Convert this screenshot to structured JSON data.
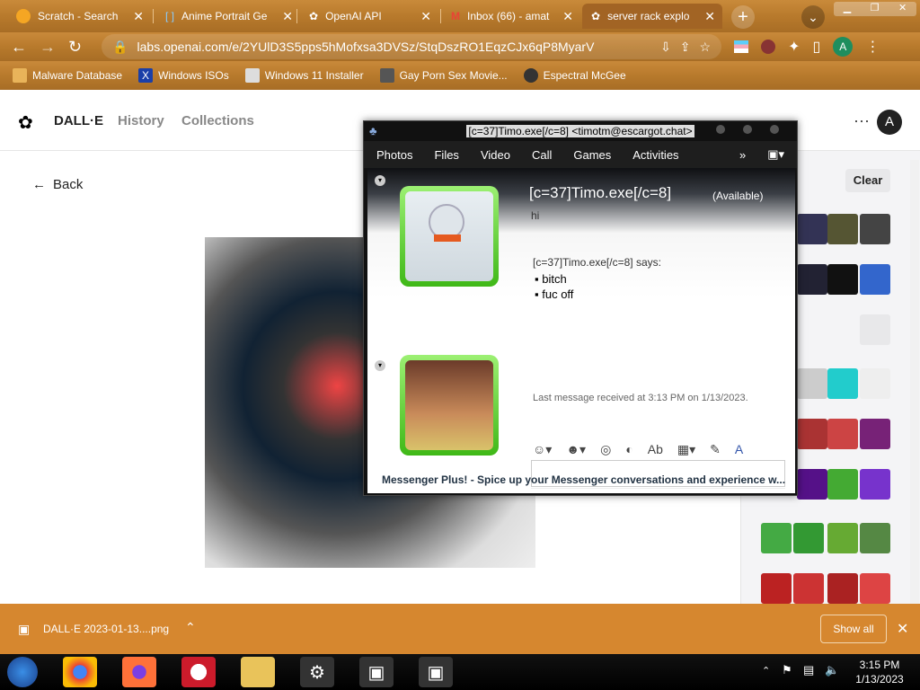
{
  "browser": {
    "tabs": [
      {
        "title": "Scratch - Search",
        "icon": "scratch-icon"
      },
      {
        "title": "Anime Portrait Ge",
        "icon": "brackets-icon"
      },
      {
        "title": "OpenAI API",
        "icon": "openai-icon"
      },
      {
        "title": "Inbox (66) - amat",
        "icon": "gmail-icon"
      },
      {
        "title": "server rack explo",
        "icon": "openai-icon"
      }
    ],
    "url": "labs.openai.com/e/2YUlD3S5pps5hMofxsa3DVSz/StqDszRO1EqzCJx6qP8MyarV",
    "profile_initial": "A",
    "bookmarks": [
      {
        "label": "Malware Database",
        "icon": "folder-icon"
      },
      {
        "label": "Windows ISOs",
        "icon": "x-icon"
      },
      {
        "label": "Windows 11 Installer",
        "icon": "image-icon"
      },
      {
        "label": "Gay Porn Sex Movie...",
        "icon": "tag-icon"
      },
      {
        "label": "Espectral McGee",
        "icon": "ghost-icon"
      }
    ]
  },
  "dalle": {
    "brand": "DALL·E",
    "nav": [
      "History",
      "Collections"
    ],
    "back_label": "Back",
    "clear_label": "Clear",
    "user_initial": "A"
  },
  "msn": {
    "title": "[c=37]Timo.exe[/c=8] <timotm@escargot.chat>",
    "menu": [
      "Photos",
      "Files",
      "Video",
      "Call",
      "Games",
      "Activities"
    ],
    "contact_name": "[c=37]Timo.exe[/c=8]",
    "status": "(Available)",
    "personal_message": "hi",
    "says_header": "[c=37]Timo.exe[/c=8] says:",
    "messages": [
      "bitch",
      "fuc off"
    ],
    "last_message": "Last message received at 3:13 PM on 1/13/2023.",
    "ad_text": "Messenger Plus! - Spice up your Messenger conversations and experience w..."
  },
  "download": {
    "filename": "DALL·E 2023-01-13....png",
    "show_all": "Show all"
  },
  "taskbar": {
    "time": "3:15 PM",
    "date": "1/13/2023"
  },
  "colors": {
    "tab_wood": "#b87a2c",
    "download_bar": "#d6872f",
    "msn_green": "#3fb817",
    "taskbar": "#000000"
  }
}
